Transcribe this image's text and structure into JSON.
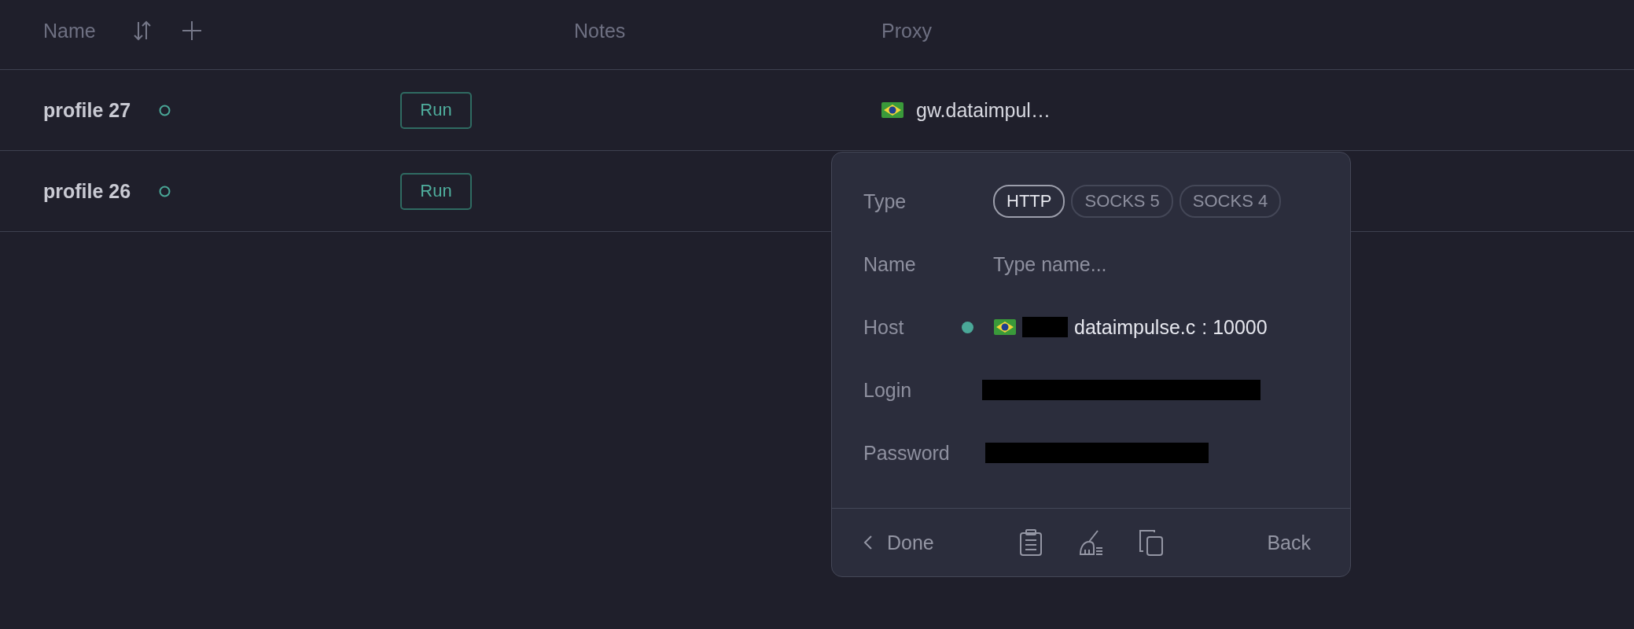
{
  "table": {
    "columns": [
      {
        "label": "Name"
      },
      {
        "label": "Notes"
      },
      {
        "label": "Proxy"
      }
    ],
    "rows": [
      {
        "name": "profile 27",
        "action": "Run",
        "proxy": "gw.dataimpul…"
      },
      {
        "name": "profile 26",
        "action": "Run",
        "proxy": ""
      }
    ]
  },
  "proxy_popup": {
    "type": {
      "label": "Type",
      "options": [
        {
          "label": "HTTP",
          "selected": true
        },
        {
          "label": "SOCKS 5",
          "selected": false
        },
        {
          "label": "SOCKS 4",
          "selected": false
        }
      ]
    },
    "name": {
      "label": "Name",
      "placeholder": "Type name..."
    },
    "host": {
      "label": "Host",
      "online": true,
      "redacted_prefix": true,
      "value": "dataimpulse.c",
      "port": ": 10000"
    },
    "login": {
      "label": "Login",
      "redacted": true
    },
    "password": {
      "label": "Password",
      "redacted": true
    },
    "footer": {
      "done": "Done",
      "back": "Back"
    }
  }
}
